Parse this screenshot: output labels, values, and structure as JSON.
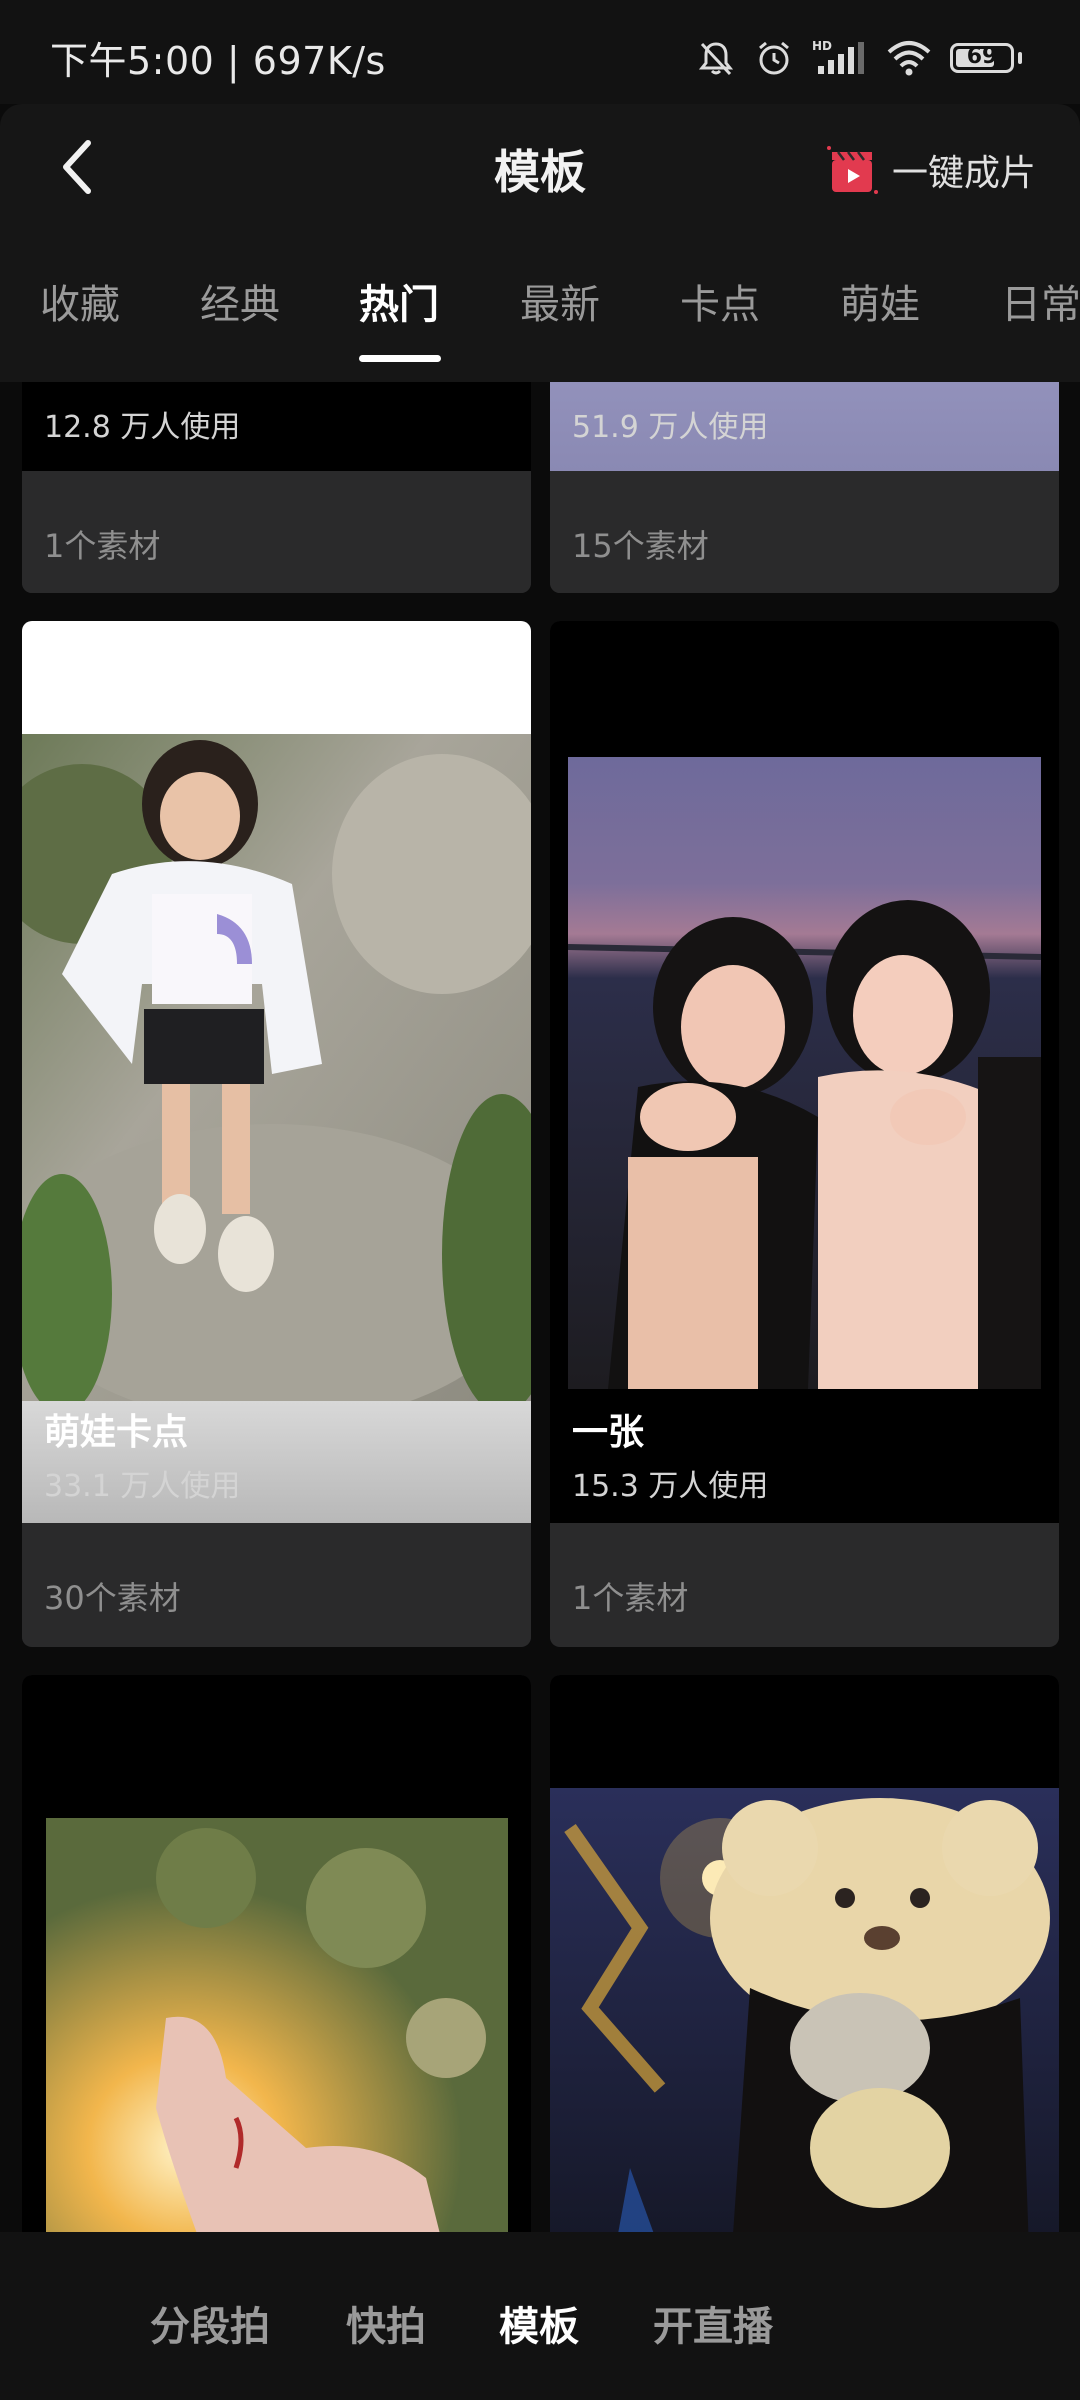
{
  "status_bar": {
    "time_speed": "下午5:00 | 697K/s",
    "battery": "69",
    "icons": [
      "mute-icon",
      "alarm-icon",
      "hd-signal-icon",
      "wifi-icon",
      "battery-icon"
    ]
  },
  "header": {
    "title": "模板",
    "oneclick_label": "一键成片"
  },
  "tabs": [
    "收藏",
    "经典",
    "热门",
    "最新",
    "卡点",
    "萌娃",
    "日常"
  ],
  "active_tab": "热门",
  "cards": [
    {
      "usage": "12.8 万人使用",
      "materials": "1个素材"
    },
    {
      "usage": "51.9 万人使用",
      "materials": "15个素材"
    },
    {
      "name": "萌娃卡点",
      "usage": "33.1 万人使用",
      "materials": "30个素材"
    },
    {
      "name": "一张",
      "usage": "15.3 万人使用",
      "materials": "1个素材"
    }
  ],
  "bottom_nav": [
    "分段拍",
    "快拍",
    "模板",
    "开直播"
  ],
  "active_nav": "模板",
  "colors": {
    "background": "#0b0b0b",
    "card": "#2a2a2b",
    "accent_icon": "#e23a4f"
  }
}
